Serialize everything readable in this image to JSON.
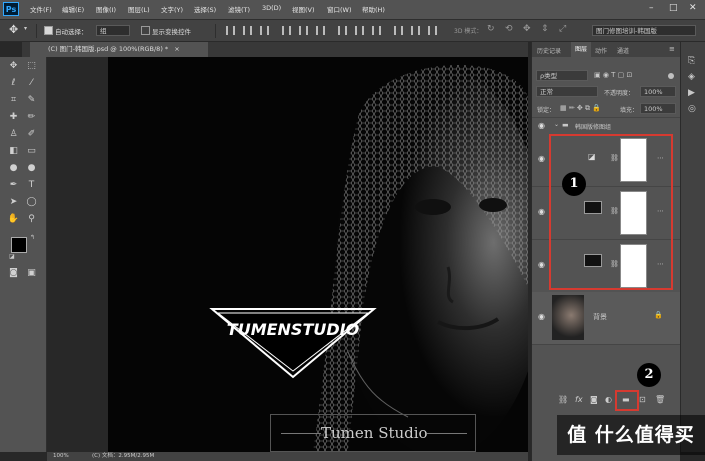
{
  "app": {
    "logo": "Ps",
    "menu": [
      "文件(F)",
      "编辑(E)",
      "图像(I)",
      "图层(L)",
      "文字(Y)",
      "选择(S)",
      "滤镜(T)",
      "3D(D)",
      "视图(V)",
      "窗口(W)",
      "帮助(H)"
    ],
    "window_controls": [
      "minimize-icon",
      "maximize-icon",
      "close-icon"
    ]
  },
  "options_bar": {
    "auto_select_label": "自动选择：",
    "auto_select_value": "组",
    "show_transform_label": "显示变换控件",
    "mode_3d_label": "3D 模式：",
    "workspace_value": "图门修图培训-韩国版"
  },
  "document": {
    "tab_title": "(C) 图门-韩国版.psd @ 100%(RGB/8) *",
    "close": "×"
  },
  "status_bar": {
    "zoom": "100%",
    "doc_info": "(C) 文档：2.95M/2.95M"
  },
  "canvas": {
    "logo_text": "TUMENSTUDIO",
    "footer_text": "Tumen Studio",
    "colors": {
      "background": "#050505",
      "accent": "#d63a30"
    }
  },
  "layers_panel": {
    "tabs": [
      "历史记录",
      "图层",
      "动作",
      "通道"
    ],
    "active_tab": "图层",
    "filter_type": "ρ类型",
    "blend_mode": "正常",
    "opacity_label": "不透明度：",
    "opacity_value": "100%",
    "lock_label": "锁定：",
    "fill_label": "填充：",
    "fill_value": "100%",
    "group_name": "韩国版修图组",
    "layers": [
      {
        "kind": "curves-adjustment",
        "visible": true
      },
      {
        "kind": "adjustment",
        "visible": true
      },
      {
        "kind": "adjustment",
        "visible": true
      }
    ],
    "background_layer": {
      "name": "背景",
      "locked": true
    },
    "bottom_icons": [
      "link-icon",
      "fx-icon",
      "mask-icon",
      "adjustment-icon",
      "new-group-icon",
      "new-layer-icon",
      "delete-icon"
    ]
  },
  "annotations": [
    {
      "label": "1",
      "target": "adjustment-layers"
    },
    {
      "label": "2",
      "target": "new-group-button"
    }
  ],
  "watermark": "值 什么值得买"
}
